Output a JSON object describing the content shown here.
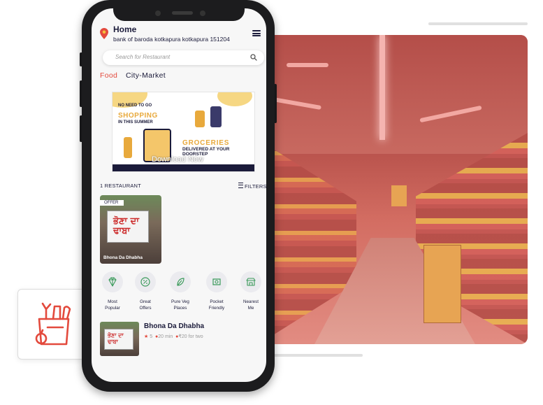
{
  "header": {
    "title": "Home",
    "address": "bank of baroda kotkapura kotkapura 151204"
  },
  "search": {
    "placeholder": "Search for Restaurant"
  },
  "tabs": [
    {
      "label": "Food",
      "active": true
    },
    {
      "label": "City-Market",
      "active": false
    }
  ],
  "banner": {
    "line1": "NO NEED TO GO",
    "line2": "SHOPPING",
    "line3": "IN THIS SUMMER",
    "line4": "GROCERIES",
    "line5": "DELIVERED AT YOUR",
    "line6": "DOORSTEP",
    "cta": "Download Now"
  },
  "results": {
    "count": "1 RESTAURANT",
    "filters": "FILTERS"
  },
  "featured": {
    "badge": "OFFER",
    "sign_text": "ਭੋਣਾ ਦਾ ਢਾਬਾ",
    "name": "Bhona Da Dhabha"
  },
  "categories": [
    {
      "line1": "Most",
      "line2": "Popular",
      "icon": "diamond-icon"
    },
    {
      "line1": "Great",
      "line2": "Offers",
      "icon": "percent-badge-icon"
    },
    {
      "line1": "Pure Veg",
      "line2": "Places",
      "icon": "leaf-icon"
    },
    {
      "line1": "Pocket",
      "line2": "Friendly",
      "icon": "wallet-icon"
    },
    {
      "line1": "Nearest",
      "line2": "Me",
      "icon": "store-icon"
    }
  ],
  "list": [
    {
      "name": "Bhona Da Dhabha",
      "sign_text": "ਭੋਣਾ ਦਾ ਢਾਬਾ",
      "rating": "5",
      "time": "20 min",
      "price": "₹20 for two"
    }
  ],
  "colors": {
    "accent": "#e34a3d",
    "text": "#1b1b3a",
    "phone_body": "#1c1c1e"
  }
}
